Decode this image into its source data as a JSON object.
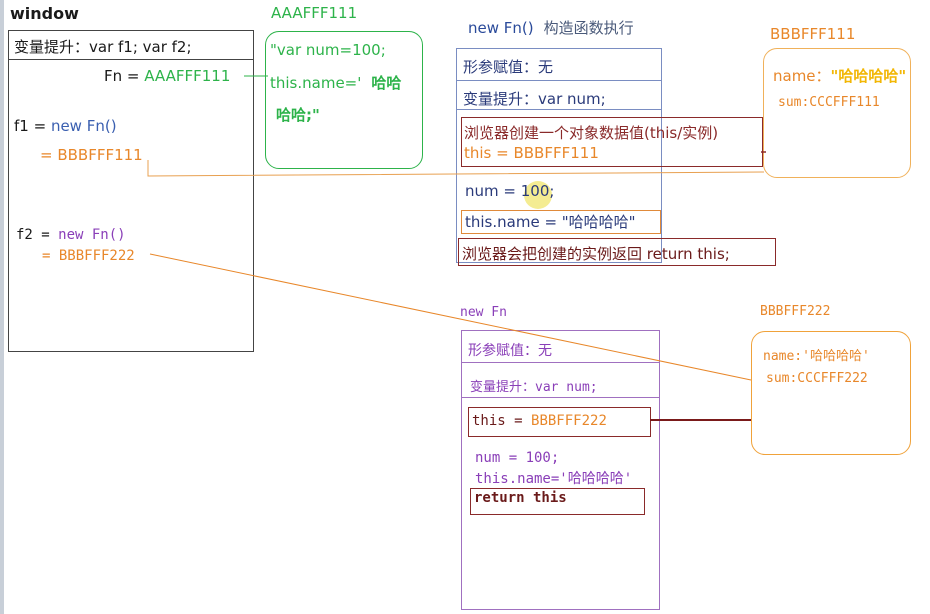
{
  "colors": {
    "green": "#2db34a",
    "orange": "#e8872a",
    "dark_red": "#8a2a2a",
    "purple": "#8a3fb8",
    "blue_frame": "#7a8dc2",
    "yellow": "#f2b705",
    "text": "#1a1a1a"
  },
  "window": {
    "title": "window",
    "hoist": "变量提升：var f1;  var f2;",
    "fn_label": "Fn = ",
    "fn_addr": "AAAFFF111",
    "f1_label": "f1 = ",
    "f1_value": "new Fn()",
    "f1_eq": "= ",
    "f1_addr": "BBBFFF111",
    "f2_label": "f2 = ",
    "f2_value": "new Fn()",
    "f2_eq": "= ",
    "f2_addr": "BBBFFF222"
  },
  "heap_aaa": {
    "label": "AAAFFF111",
    "line1": "\"var num=100;",
    "line2_a": "this.name='",
    "line2_b": "哈哈",
    "line3": "哈哈;\""
  },
  "exec1": {
    "title_a": "new Fn()",
    "title_b": "构造函数执行",
    "params": "形参赋值：无",
    "hoist": "变量提升：var num;",
    "create": "浏览器创建一个对象数据值(this/实例)",
    "this_line": "this = BBBFFF111",
    "num": "num = 100;",
    "this_name": "this.name = \"哈哈哈哈\"",
    "return": "浏览器会把创建的实例返回 return this;"
  },
  "heap_bbb1": {
    "label": "BBBFFF111",
    "name_key": "name：",
    "name_val": "\"哈哈哈哈\"",
    "sum": "sum:CCCFFF111"
  },
  "exec2": {
    "title": "new Fn",
    "params": "形参赋值：无",
    "hoist": "变量提升：var num;",
    "this_key": "this = ",
    "this_addr": "BBBFFF222",
    "num": "num = 100;",
    "this_name": "this.name='哈哈哈哈'",
    "return": "return this"
  },
  "heap_bbb2": {
    "label": "BBBFFF222",
    "name_key": "name:",
    "name_val": "'哈哈哈哈'",
    "sum": "sum:CCCFFF222"
  }
}
